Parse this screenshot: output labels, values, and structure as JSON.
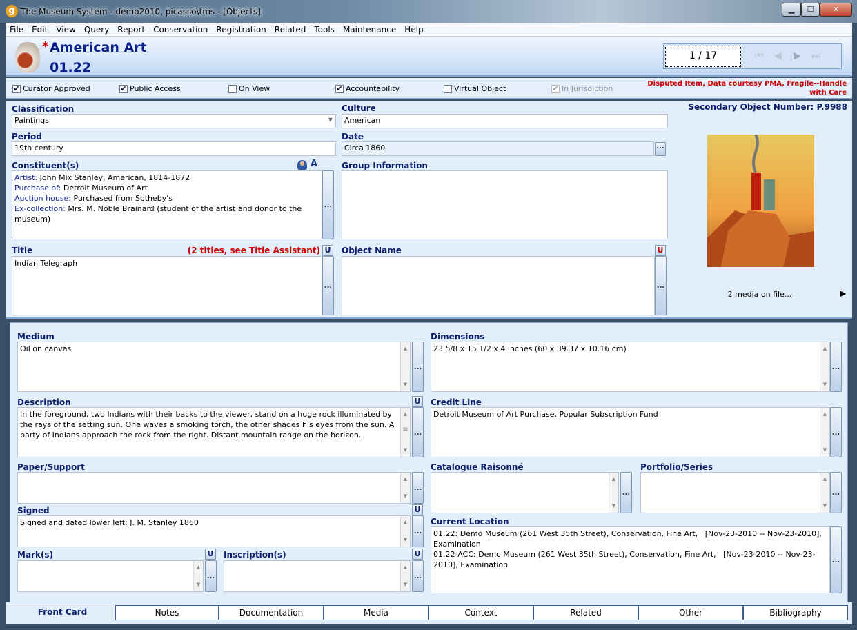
{
  "window": {
    "title": "The Museum System - demo2010, picasso\\tms - [Objects]",
    "minimize": "▁",
    "maximize": "☐",
    "close": "✕"
  },
  "menu": [
    "File",
    "Edit",
    "View",
    "Query",
    "Report",
    "Conservation",
    "Registration",
    "Related",
    "Tools",
    "Maintenance",
    "Help"
  ],
  "header": {
    "modified_marker": "*",
    "department": "American Art",
    "object_number": "01.22",
    "record_position": "1 / 17"
  },
  "checkboxes": [
    {
      "label": "Curator Approved",
      "checked": true
    },
    {
      "label": "Public Access",
      "checked": true
    },
    {
      "label": "On View",
      "checked": false
    },
    {
      "label": "Accountability",
      "checked": true
    },
    {
      "label": "Virtual Object",
      "checked": false
    },
    {
      "label": "In Jurisdiction",
      "checked": true,
      "disabled": true
    }
  ],
  "flags": {
    "line1": "Disputed Item, Data courtesy PMA, Fragile--Handle",
    "line2": "with Care"
  },
  "fields": {
    "classification": {
      "label": "Classification",
      "value": "Paintings"
    },
    "culture": {
      "label": "Culture",
      "value": "American"
    },
    "period": {
      "label": "Period",
      "value": "19th century"
    },
    "date": {
      "label": "Date",
      "value": "Circa 1860"
    },
    "constituents": {
      "label": "Constituent(s)",
      "items": [
        {
          "role": "Artist:",
          "name": " John Mix Stanley, American, 1814-1872"
        },
        {
          "role": "Purchase of:",
          "name": "  Detroit Museum of Art"
        },
        {
          "role": "Auction house:",
          "name": " Purchased from Sotheby's"
        },
        {
          "role": "Ex-collection:",
          "name": "  Mrs. M. Noble Brainard (student of the artist and donor to the museum)"
        }
      ]
    },
    "group_information": {
      "label": "Group Information",
      "value": ""
    },
    "title": {
      "label": "Title",
      "note": "(2 titles, see Title Assistant)",
      "value": "Indian Telegraph"
    },
    "object_name": {
      "label": "Object Name",
      "value": ""
    },
    "secondary_object_number": "Secondary Object Number: P.9988",
    "media_count": "2 media on file...",
    "medium": {
      "label": "Medium",
      "value": "Oil on canvas"
    },
    "dimensions": {
      "label": "Dimensions",
      "value": "23 5/8 x 15 1/2 x 4 inches (60 x 39.37 x 10.16 cm)"
    },
    "description": {
      "label": "Description",
      "value": "In the foreground, two Indians with their backs to the viewer, stand on a huge rock illuminated by the rays of the setting sun.  One waves a smoking torch, the other shades his eyes from the sun.  A party of Indians approach the rock from the right.  Distant mountain range on the horizon."
    },
    "credit_line": {
      "label": "Credit Line",
      "value": "Detroit Museum of Art Purchase, Popular Subscription Fund"
    },
    "paper_support": {
      "label": "Paper/Support",
      "value": ""
    },
    "catalogue_raisonne": {
      "label": "Catalogue Raisonné",
      "value": ""
    },
    "portfolio_series": {
      "label": "Portfolio/Series",
      "value": ""
    },
    "signed": {
      "label": "Signed",
      "value": "Signed and dated lower left:  J. M. Stanley 1860"
    },
    "current_location": {
      "label": "Current Location",
      "value": "01.22: Demo Museum (261 West 35th Street), Conservation, Fine Art,   [Nov-23-2010 -- Nov-23-2010], Examination\n01.22-ACC: Demo Museum (261 West 35th Street), Conservation, Fine Art,   [Nov-23-2010 -- Nov-23-2010], Examination"
    },
    "marks": {
      "label": "Mark(s)",
      "value": ""
    },
    "inscriptions": {
      "label": "Inscription(s)",
      "value": ""
    }
  },
  "buttons": {
    "ellipsis": "...",
    "unicode": "U"
  },
  "tabs": [
    "Front Card",
    "Notes",
    "Documentation",
    "Media",
    "Context",
    "Related",
    "Other",
    "Bibliography"
  ],
  "colors": {
    "label": "#0b1f6a",
    "header_text": "#0b1f8a",
    "alert": "#cc0000"
  }
}
